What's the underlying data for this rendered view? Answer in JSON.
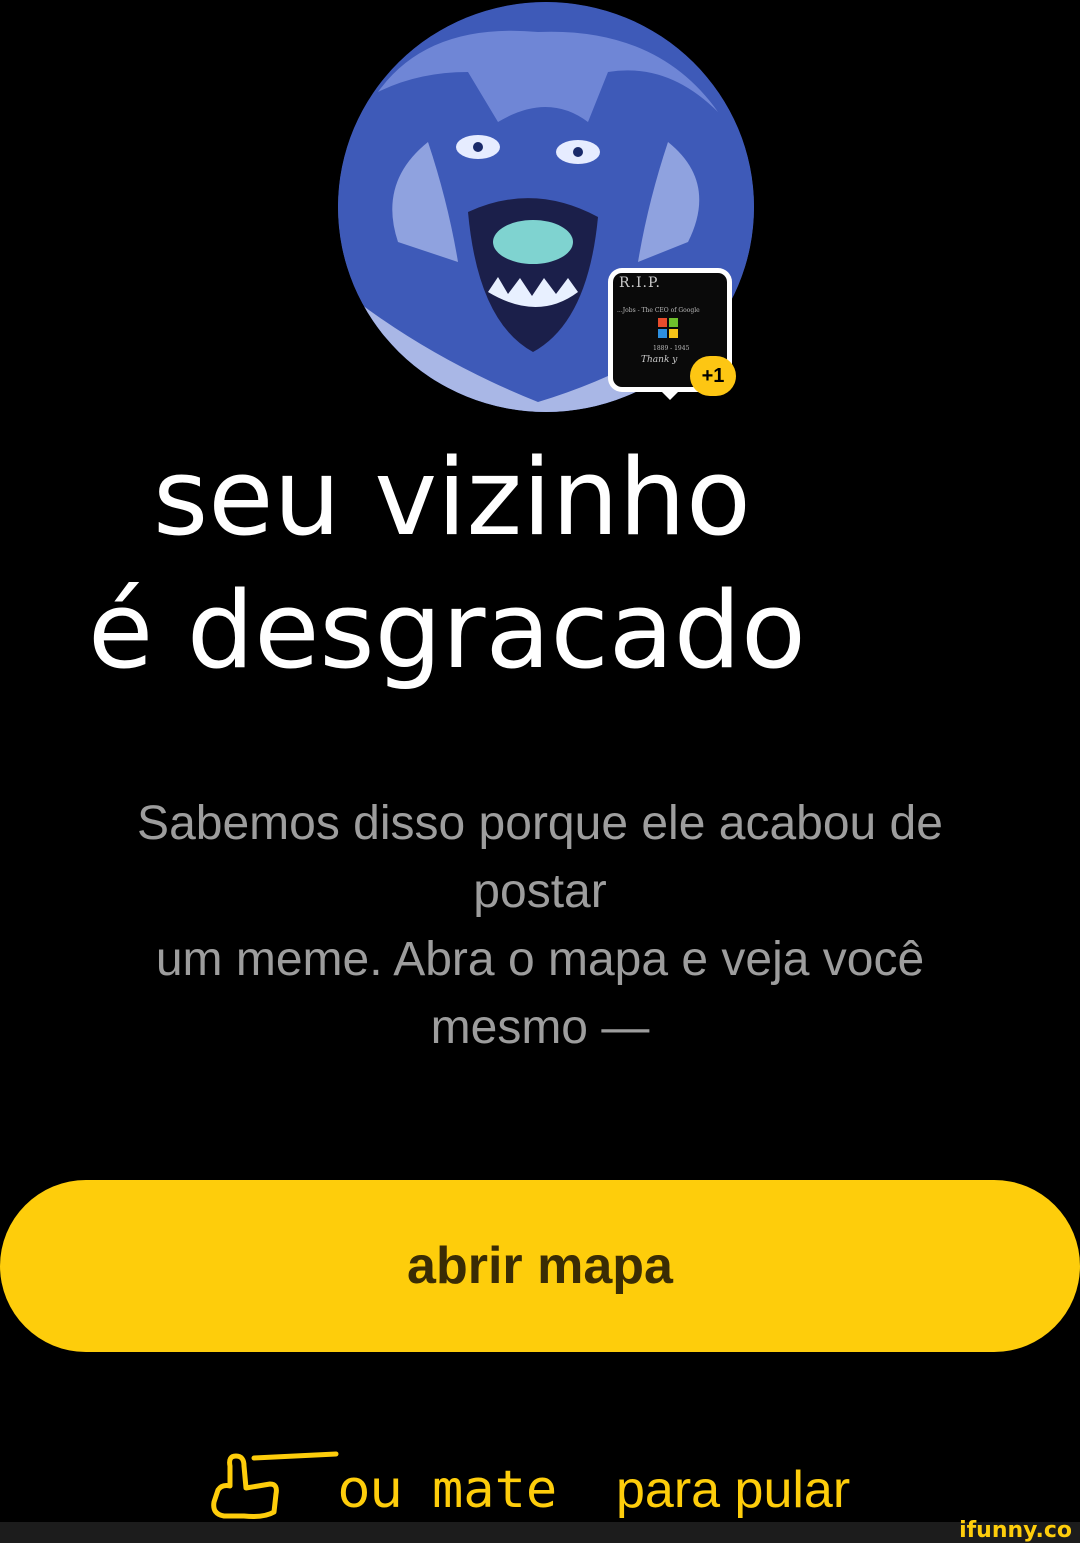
{
  "profile": {
    "avatar_icon": "inverted-dog-photo",
    "thumb_title": "R.I.P.",
    "thumb_caption": "...Jobs - The CEO of Google",
    "thumb_years": "1889 - 1945",
    "thumb_thanks": "Thank y",
    "badge": "+1"
  },
  "headline": {
    "line1": "seu vizinho",
    "line2": "é desgracado"
  },
  "body": {
    "line1": "Sabemos disso porque ele acabou de",
    "line2": "postar",
    "line3": "um meme. Abra o mapa e veja você",
    "line4": "mesmo —"
  },
  "cta": {
    "label": "abrir mapa"
  },
  "skip": {
    "icon": "swipe-hand-icon",
    "ou": "ou",
    "mate": "mate",
    "rest": "para pular"
  },
  "watermark": "ifunny.co",
  "colors": {
    "accent": "#fecd0b",
    "background": "#000000",
    "body_text": "#9d9d9d"
  }
}
